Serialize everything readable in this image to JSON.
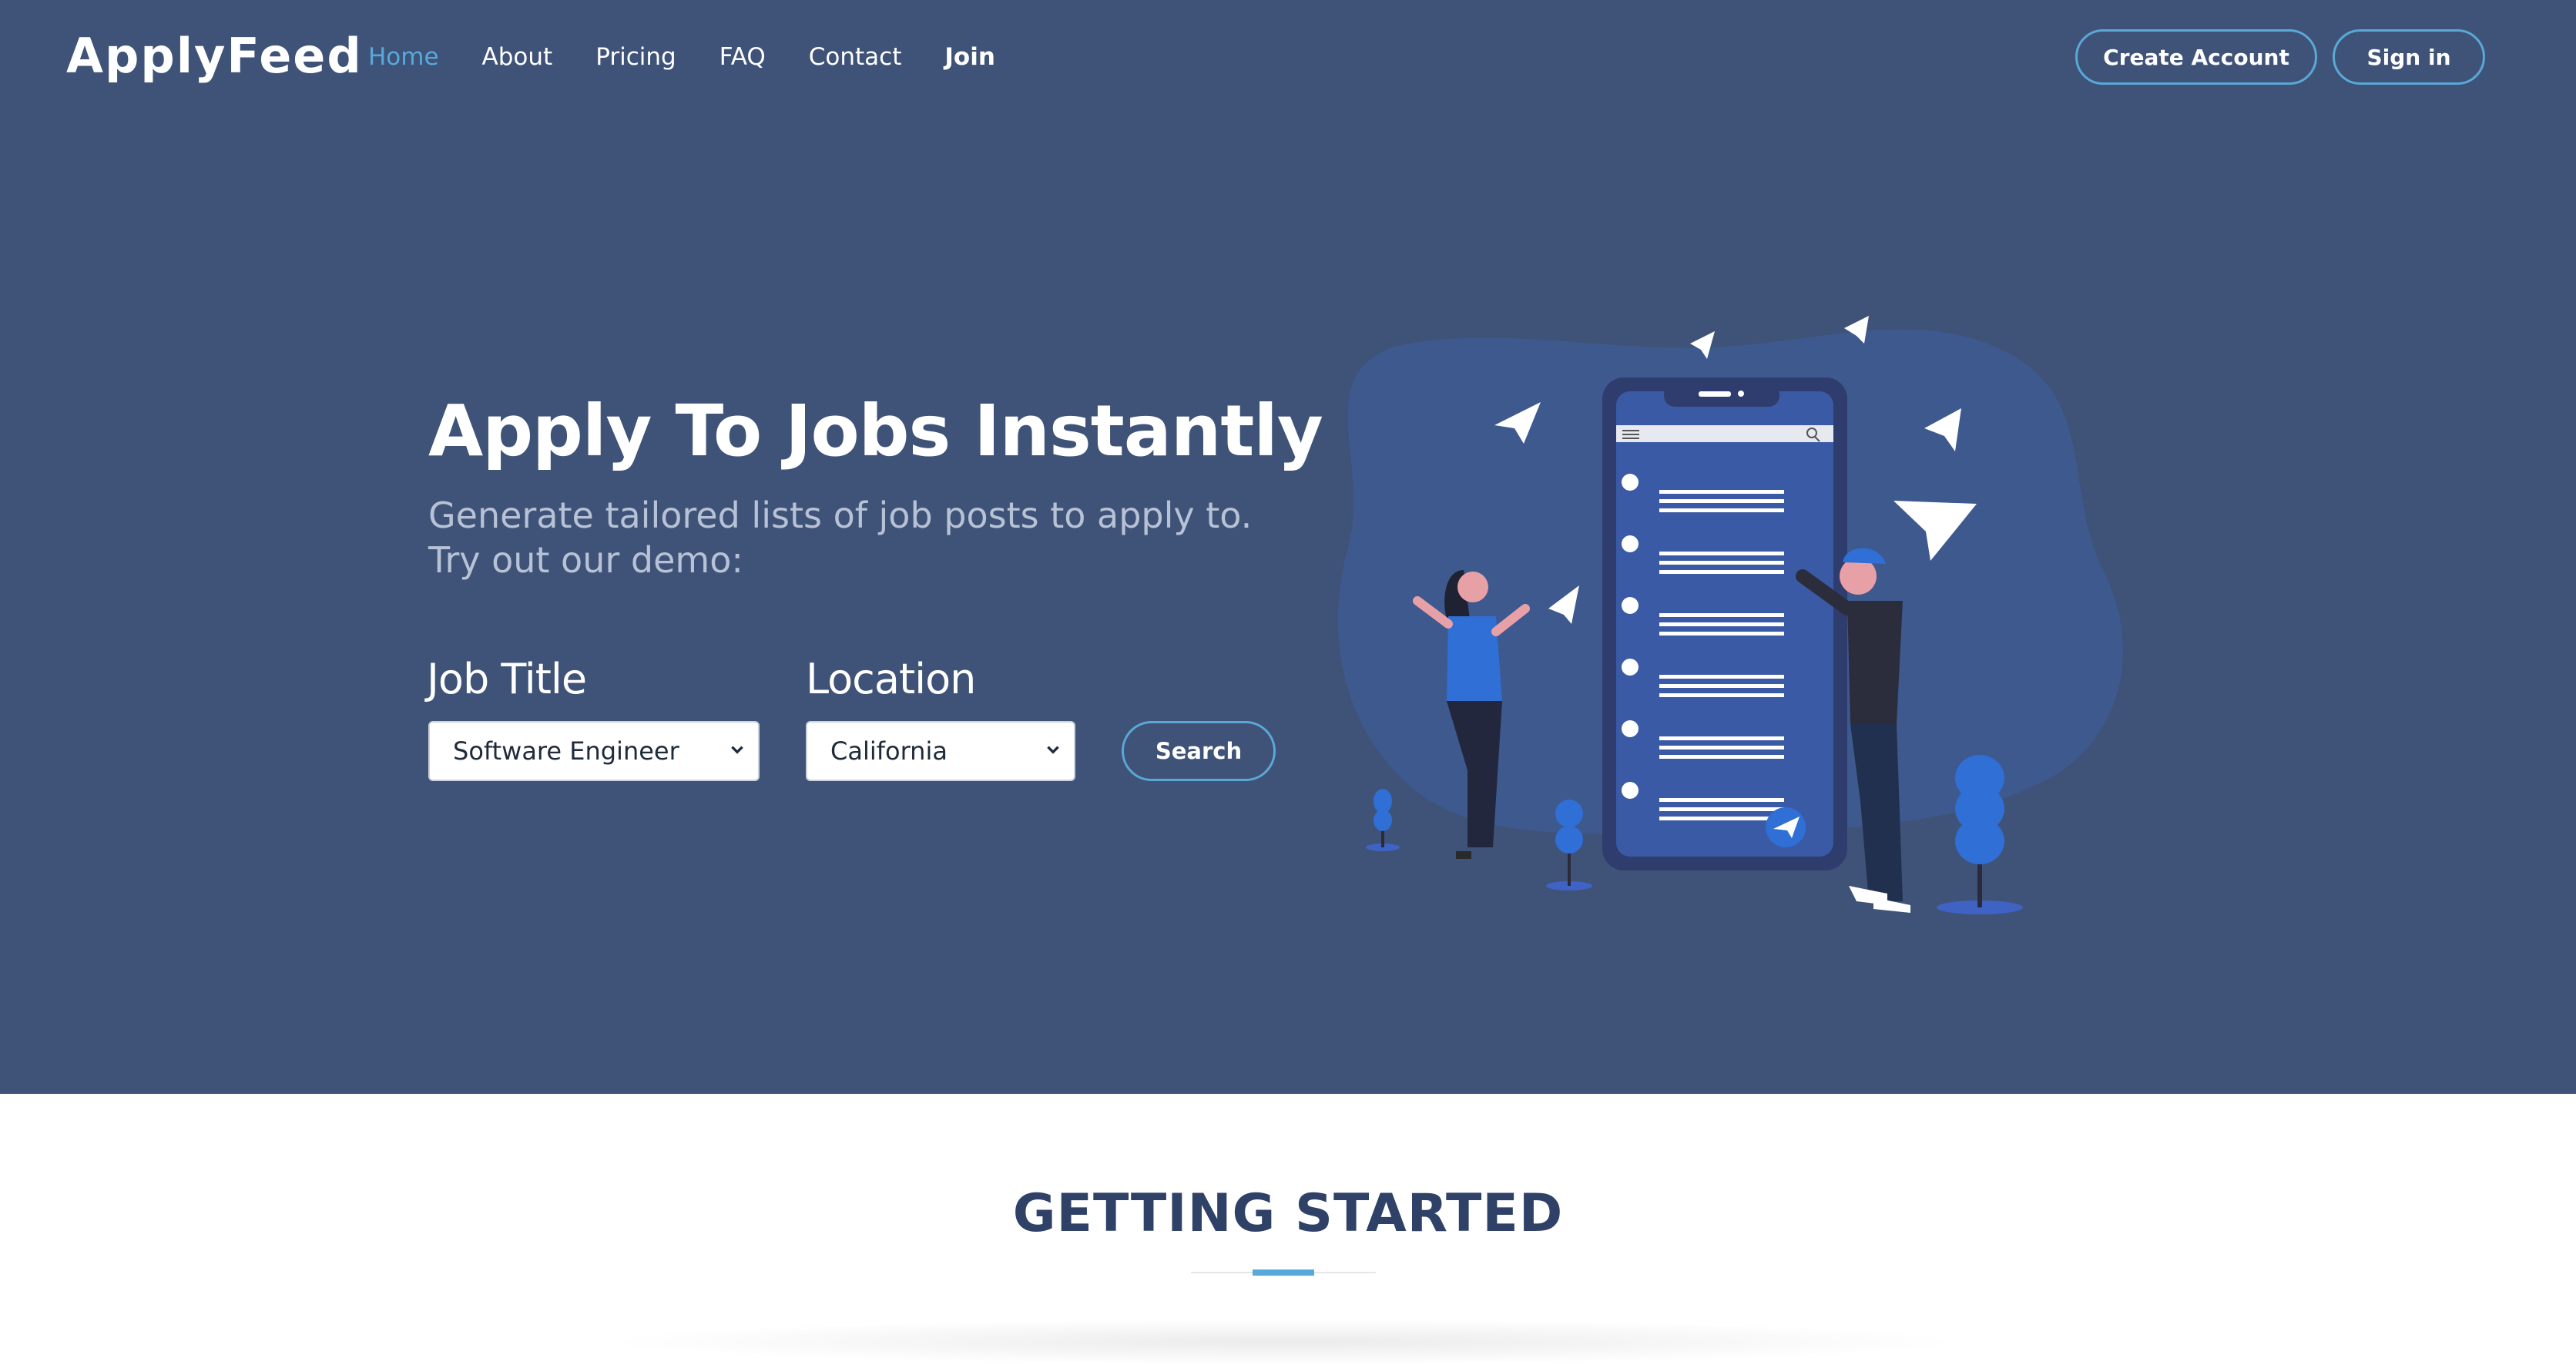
{
  "brand": "ApplyFeed",
  "nav": [
    "Home",
    "About",
    "Pricing",
    "FAQ",
    "Contact",
    "Join"
  ],
  "header_actions": {
    "create_account": "Create Account",
    "sign_in": "Sign in"
  },
  "hero": {
    "title": "Apply To Jobs Instantly",
    "subtitle_line1": "Generate tailored lists of job posts to apply to.",
    "subtitle_line2": "Try out our demo:"
  },
  "search_form": {
    "job_title_label": "Job Title",
    "job_title_value": "Software Engineer",
    "location_label": "Location",
    "location_value": "California",
    "search_button": "Search"
  },
  "getting_started": {
    "title": "GETTING STARTED"
  },
  "colors": {
    "hero_bg": "#3f5378",
    "accent": "#57a9dc",
    "heading": "#2f4166"
  },
  "icons": [
    "chevron-down-icon",
    "paper-plane-icon",
    "menu-icon",
    "search-icon"
  ]
}
